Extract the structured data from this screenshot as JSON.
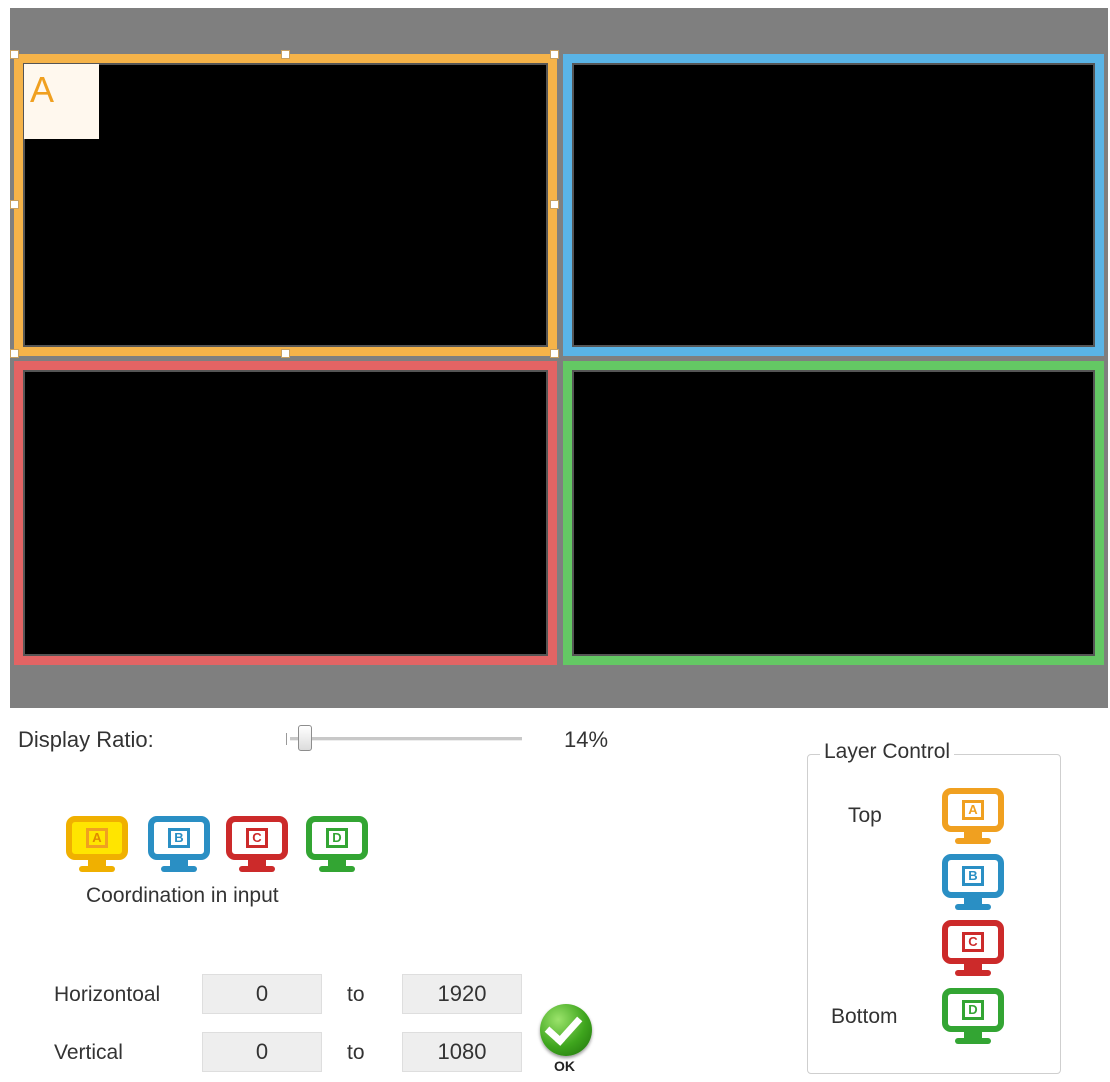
{
  "preview": {
    "selected_window_label": "A",
    "windows": [
      {
        "id": "A",
        "color": "#f5b349"
      },
      {
        "id": "B",
        "color": "#5ab4e6"
      },
      {
        "id": "C",
        "color": "#e36464"
      },
      {
        "id": "D",
        "color": "#64c864"
      }
    ]
  },
  "display_ratio": {
    "label": "Display Ratio:",
    "value_text": "14%",
    "value": 14
  },
  "input_selector": {
    "buttons": [
      {
        "letter": "A",
        "color": "#f0a020",
        "active": true
      },
      {
        "letter": "B",
        "color": "#2a8fc4"
      },
      {
        "letter": "C",
        "color": "#cc2a2a"
      },
      {
        "letter": "D",
        "color": "#33a533"
      }
    ],
    "caption": "Coordination in input"
  },
  "coordinates": {
    "horizontal": {
      "label": "Horizontoal",
      "from": "0",
      "to_word": "to",
      "to": "1920"
    },
    "vertical": {
      "label": "Vertical",
      "from": "0",
      "to_word": "to",
      "to": "1080"
    }
  },
  "ok_button": {
    "label": "OK"
  },
  "layer_control": {
    "title": "Layer Control",
    "top_label": "Top",
    "bottom_label": "Bottom",
    "layers": [
      {
        "letter": "A",
        "color": "#f0a020"
      },
      {
        "letter": "B",
        "color": "#2a8fc4"
      },
      {
        "letter": "C",
        "color": "#cc2a2a"
      },
      {
        "letter": "D",
        "color": "#33a533"
      }
    ]
  }
}
